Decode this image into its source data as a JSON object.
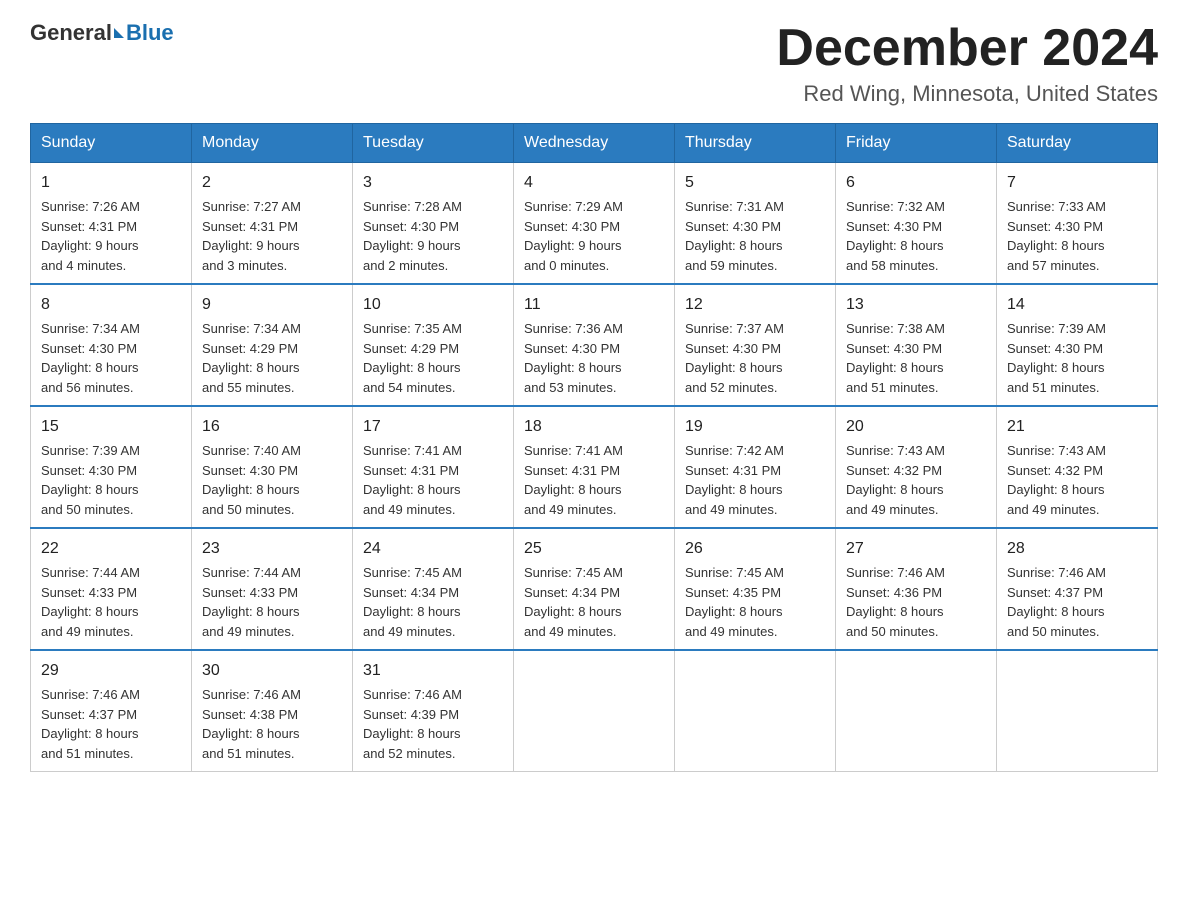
{
  "header": {
    "logo_general": "General",
    "logo_blue": "Blue",
    "title": "December 2024",
    "subtitle": "Red Wing, Minnesota, United States"
  },
  "days_of_week": [
    "Sunday",
    "Monday",
    "Tuesday",
    "Wednesday",
    "Thursday",
    "Friday",
    "Saturday"
  ],
  "weeks": [
    [
      {
        "day": "1",
        "sunrise": "7:26 AM",
        "sunset": "4:31 PM",
        "daylight": "9 hours and 4 minutes."
      },
      {
        "day": "2",
        "sunrise": "7:27 AM",
        "sunset": "4:31 PM",
        "daylight": "9 hours and 3 minutes."
      },
      {
        "day": "3",
        "sunrise": "7:28 AM",
        "sunset": "4:30 PM",
        "daylight": "9 hours and 2 minutes."
      },
      {
        "day": "4",
        "sunrise": "7:29 AM",
        "sunset": "4:30 PM",
        "daylight": "9 hours and 0 minutes."
      },
      {
        "day": "5",
        "sunrise": "7:31 AM",
        "sunset": "4:30 PM",
        "daylight": "8 hours and 59 minutes."
      },
      {
        "day": "6",
        "sunrise": "7:32 AM",
        "sunset": "4:30 PM",
        "daylight": "8 hours and 58 minutes."
      },
      {
        "day": "7",
        "sunrise": "7:33 AM",
        "sunset": "4:30 PM",
        "daylight": "8 hours and 57 minutes."
      }
    ],
    [
      {
        "day": "8",
        "sunrise": "7:34 AM",
        "sunset": "4:30 PM",
        "daylight": "8 hours and 56 minutes."
      },
      {
        "day": "9",
        "sunrise": "7:34 AM",
        "sunset": "4:29 PM",
        "daylight": "8 hours and 55 minutes."
      },
      {
        "day": "10",
        "sunrise": "7:35 AM",
        "sunset": "4:29 PM",
        "daylight": "8 hours and 54 minutes."
      },
      {
        "day": "11",
        "sunrise": "7:36 AM",
        "sunset": "4:30 PM",
        "daylight": "8 hours and 53 minutes."
      },
      {
        "day": "12",
        "sunrise": "7:37 AM",
        "sunset": "4:30 PM",
        "daylight": "8 hours and 52 minutes."
      },
      {
        "day": "13",
        "sunrise": "7:38 AM",
        "sunset": "4:30 PM",
        "daylight": "8 hours and 51 minutes."
      },
      {
        "day": "14",
        "sunrise": "7:39 AM",
        "sunset": "4:30 PM",
        "daylight": "8 hours and 51 minutes."
      }
    ],
    [
      {
        "day": "15",
        "sunrise": "7:39 AM",
        "sunset": "4:30 PM",
        "daylight": "8 hours and 50 minutes."
      },
      {
        "day": "16",
        "sunrise": "7:40 AM",
        "sunset": "4:30 PM",
        "daylight": "8 hours and 50 minutes."
      },
      {
        "day": "17",
        "sunrise": "7:41 AM",
        "sunset": "4:31 PM",
        "daylight": "8 hours and 49 minutes."
      },
      {
        "day": "18",
        "sunrise": "7:41 AM",
        "sunset": "4:31 PM",
        "daylight": "8 hours and 49 minutes."
      },
      {
        "day": "19",
        "sunrise": "7:42 AM",
        "sunset": "4:31 PM",
        "daylight": "8 hours and 49 minutes."
      },
      {
        "day": "20",
        "sunrise": "7:43 AM",
        "sunset": "4:32 PM",
        "daylight": "8 hours and 49 minutes."
      },
      {
        "day": "21",
        "sunrise": "7:43 AM",
        "sunset": "4:32 PM",
        "daylight": "8 hours and 49 minutes."
      }
    ],
    [
      {
        "day": "22",
        "sunrise": "7:44 AM",
        "sunset": "4:33 PM",
        "daylight": "8 hours and 49 minutes."
      },
      {
        "day": "23",
        "sunrise": "7:44 AM",
        "sunset": "4:33 PM",
        "daylight": "8 hours and 49 minutes."
      },
      {
        "day": "24",
        "sunrise": "7:45 AM",
        "sunset": "4:34 PM",
        "daylight": "8 hours and 49 minutes."
      },
      {
        "day": "25",
        "sunrise": "7:45 AM",
        "sunset": "4:34 PM",
        "daylight": "8 hours and 49 minutes."
      },
      {
        "day": "26",
        "sunrise": "7:45 AM",
        "sunset": "4:35 PM",
        "daylight": "8 hours and 49 minutes."
      },
      {
        "day": "27",
        "sunrise": "7:46 AM",
        "sunset": "4:36 PM",
        "daylight": "8 hours and 50 minutes."
      },
      {
        "day": "28",
        "sunrise": "7:46 AM",
        "sunset": "4:37 PM",
        "daylight": "8 hours and 50 minutes."
      }
    ],
    [
      {
        "day": "29",
        "sunrise": "7:46 AM",
        "sunset": "4:37 PM",
        "daylight": "8 hours and 51 minutes."
      },
      {
        "day": "30",
        "sunrise": "7:46 AM",
        "sunset": "4:38 PM",
        "daylight": "8 hours and 51 minutes."
      },
      {
        "day": "31",
        "sunrise": "7:46 AM",
        "sunset": "4:39 PM",
        "daylight": "8 hours and 52 minutes."
      },
      null,
      null,
      null,
      null
    ]
  ],
  "labels": {
    "sunrise": "Sunrise:",
    "sunset": "Sunset:",
    "daylight": "Daylight:"
  }
}
